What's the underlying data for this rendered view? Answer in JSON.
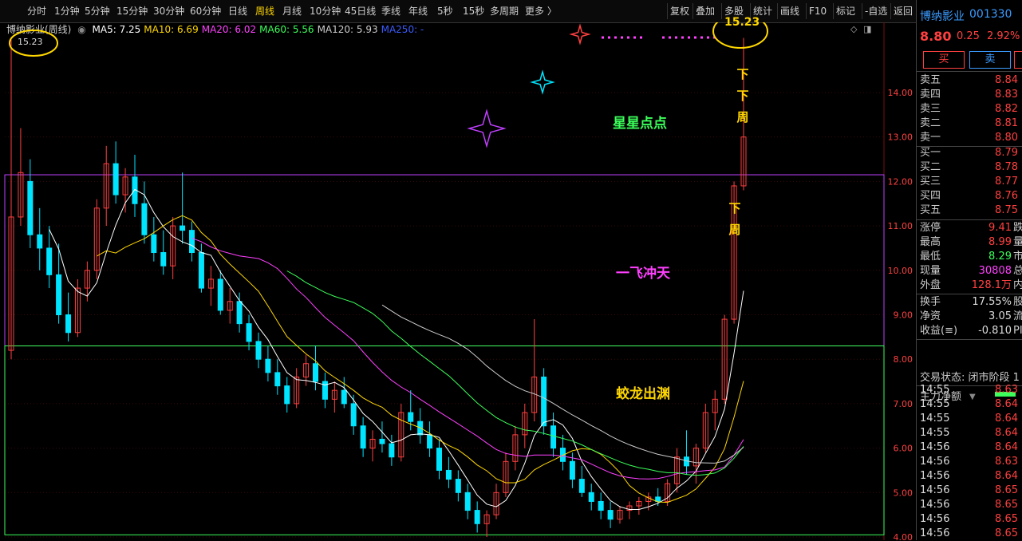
{
  "toolbar": {
    "periods": [
      "分时",
      "1分钟",
      "5分钟",
      "15分钟",
      "30分钟",
      "60分钟",
      "日线",
      "周线",
      "月线",
      "10分钟",
      "45日线",
      "季线",
      "年线",
      "5秒",
      "15秒",
      "多周期",
      "更多 〉"
    ],
    "active_period": "周线",
    "right_buttons": [
      "复权",
      "叠加",
      "多股",
      "统计",
      "画线",
      "F10",
      "标记",
      "-自选",
      "返回"
    ]
  },
  "ma_bar": {
    "title": "博纳影业(周线)",
    "items": [
      {
        "label": "MA5:",
        "value": "7.25",
        "color": "#ffffff"
      },
      {
        "label": "MA10:",
        "value": "6.69",
        "color": "#ffd700"
      },
      {
        "label": "MA20:",
        "value": "6.02",
        "color": "#ff40ff"
      },
      {
        "label": "MA60:",
        "value": "5.56",
        "color": "#3bff5a"
      },
      {
        "label": "MA120:",
        "value": "5.93",
        "color": "#cccccc"
      },
      {
        "label": "MA250:",
        "value": "-",
        "color": "#3b5bff"
      }
    ]
  },
  "annotations": {
    "high_left": "15.23",
    "high_right": "15.23",
    "stars_text": "星星点点",
    "soar_text": "一飞冲天",
    "dragon_text": "蛟龙出渊",
    "down_week_1": [
      "下",
      "下",
      "周"
    ],
    "down_week_2": [
      "下",
      "周"
    ]
  },
  "colors": {
    "up": "#ff4040",
    "down": "#00e5ff",
    "ma5": "#ffffff",
    "ma10": "#ffd700",
    "ma20": "#ff40ff",
    "ma60": "#3bff5a",
    "ma120": "#cccccc"
  },
  "chart_data": {
    "type": "candlestick",
    "title": "博纳影业(周线)",
    "y_ticks": [
      "14.00",
      "13.00",
      "12.00",
      "11.00",
      "10.00",
      "9.00",
      "8.00",
      "7.00",
      "6.00",
      "5.00",
      "4.00"
    ],
    "ylim": [
      4.0,
      15.4
    ],
    "candles_ohlc": [
      [
        8.2,
        15.2,
        8.0,
        11.2
      ],
      [
        11.2,
        13.2,
        11.0,
        12.2
      ],
      [
        12.0,
        12.5,
        10.5,
        10.8
      ],
      [
        10.8,
        11.4,
        10.0,
        10.5
      ],
      [
        10.5,
        11.0,
        9.6,
        9.9
      ],
      [
        9.9,
        10.6,
        8.8,
        9.0
      ],
      [
        9.0,
        9.5,
        8.4,
        8.6
      ],
      [
        8.6,
        9.8,
        8.5,
        9.6
      ],
      [
        9.6,
        10.2,
        9.3,
        10.0
      ],
      [
        10.0,
        11.6,
        9.8,
        11.4
      ],
      [
        11.4,
        12.8,
        11.0,
        12.4
      ],
      [
        12.4,
        12.9,
        11.5,
        11.7
      ],
      [
        11.7,
        12.3,
        11.3,
        12.1
      ],
      [
        12.1,
        12.6,
        11.2,
        11.5
      ],
      [
        11.5,
        12.0,
        10.6,
        10.8
      ],
      [
        10.8,
        11.2,
        10.2,
        10.4
      ],
      [
        10.4,
        10.9,
        9.9,
        10.1
      ],
      [
        10.1,
        11.2,
        9.8,
        11.0
      ],
      [
        11.0,
        12.2,
        10.6,
        10.9
      ],
      [
        10.9,
        11.1,
        10.2,
        10.4
      ],
      [
        10.4,
        10.6,
        9.5,
        9.6
      ],
      [
        9.6,
        10.1,
        9.2,
        9.8
      ],
      [
        9.8,
        10.0,
        9.0,
        9.1
      ],
      [
        9.1,
        9.6,
        8.8,
        9.3
      ],
      [
        9.3,
        9.5,
        8.6,
        8.8
      ],
      [
        8.8,
        9.0,
        8.2,
        8.4
      ],
      [
        8.4,
        8.6,
        7.8,
        8.0
      ],
      [
        8.0,
        8.3,
        7.5,
        7.7
      ],
      [
        7.7,
        8.0,
        7.2,
        7.4
      ],
      [
        7.4,
        7.6,
        6.8,
        7.0
      ],
      [
        7.0,
        7.8,
        6.9,
        7.6
      ],
      [
        7.6,
        8.1,
        7.4,
        7.9
      ],
      [
        7.9,
        8.3,
        7.3,
        7.5
      ],
      [
        7.5,
        7.7,
        6.9,
        7.1
      ],
      [
        7.1,
        7.5,
        6.8,
        7.3
      ],
      [
        7.3,
        7.6,
        6.9,
        7.0
      ],
      [
        7.0,
        7.2,
        6.3,
        6.5
      ],
      [
        6.5,
        6.7,
        5.8,
        6.0
      ],
      [
        6.0,
        6.4,
        5.7,
        6.2
      ],
      [
        6.2,
        6.6,
        5.9,
        6.1
      ],
      [
        6.1,
        6.3,
        5.6,
        5.8
      ],
      [
        5.8,
        7.0,
        5.7,
        6.8
      ],
      [
        6.8,
        7.3,
        6.4,
        6.6
      ],
      [
        6.6,
        6.9,
        6.1,
        6.3
      ],
      [
        6.3,
        6.6,
        5.8,
        6.0
      ],
      [
        6.0,
        6.2,
        5.3,
        5.5
      ],
      [
        5.5,
        5.8,
        5.1,
        5.3
      ],
      [
        5.3,
        5.5,
        4.8,
        5.0
      ],
      [
        5.0,
        5.2,
        4.4,
        4.6
      ],
      [
        4.6,
        4.8,
        4.1,
        4.3
      ],
      [
        4.3,
        4.6,
        4.0,
        4.5
      ],
      [
        4.5,
        5.2,
        4.4,
        5.0
      ],
      [
        5.0,
        5.9,
        4.9,
        5.7
      ],
      [
        5.7,
        6.5,
        5.5,
        6.3
      ],
      [
        6.3,
        7.0,
        6.0,
        6.8
      ],
      [
        6.8,
        8.9,
        6.6,
        7.6
      ],
      [
        7.6,
        7.8,
        6.3,
        6.5
      ],
      [
        6.5,
        6.8,
        5.8,
        6.0
      ],
      [
        6.0,
        6.3,
        5.5,
        5.7
      ],
      [
        5.7,
        5.9,
        5.1,
        5.3
      ],
      [
        5.3,
        5.6,
        4.9,
        5.0
      ],
      [
        5.0,
        5.2,
        4.6,
        4.8
      ],
      [
        4.8,
        5.0,
        4.4,
        4.6
      ],
      [
        4.6,
        4.8,
        4.2,
        4.4
      ],
      [
        4.4,
        4.7,
        4.3,
        4.6
      ],
      [
        4.6,
        4.8,
        4.4,
        4.7
      ],
      [
        4.7,
        4.9,
        4.5,
        4.8
      ],
      [
        4.8,
        5.0,
        4.6,
        4.9
      ],
      [
        4.9,
        5.1,
        4.7,
        4.8
      ],
      [
        4.8,
        5.3,
        4.7,
        5.2
      ],
      [
        5.2,
        6.0,
        5.0,
        5.8
      ],
      [
        5.8,
        6.4,
        5.4,
        5.6
      ],
      [
        5.6,
        6.1,
        5.2,
        6.0
      ],
      [
        6.0,
        7.0,
        5.9,
        6.8
      ],
      [
        6.8,
        7.3,
        6.4,
        7.1
      ],
      [
        7.1,
        9.0,
        7.0,
        8.9
      ],
      [
        8.9,
        12.0,
        8.8,
        11.9
      ],
      [
        11.9,
        15.23,
        11.8,
        13.0
      ]
    ],
    "ma_series": [
      "MA5",
      "MA10",
      "MA20",
      "MA60",
      "MA120"
    ]
  },
  "panel": {
    "name": "博纳影业",
    "code": "001330",
    "price": "8.80",
    "change": "0.25",
    "pct": "2.92%",
    "buy_btn": "买",
    "sell_btn": "卖",
    "asks": [
      {
        "k": "卖五",
        "v": "8.84"
      },
      {
        "k": "卖四",
        "v": "8.83"
      },
      {
        "k": "卖三",
        "v": "8.82"
      },
      {
        "k": "卖二",
        "v": "8.81"
      },
      {
        "k": "卖一",
        "v": "8.80"
      }
    ],
    "bids": [
      {
        "k": "买一",
        "v": "8.79"
      },
      {
        "k": "买二",
        "v": "8.78"
      },
      {
        "k": "买三",
        "v": "8.77"
      },
      {
        "k": "买四",
        "v": "8.76"
      },
      {
        "k": "买五",
        "v": "8.75"
      }
    ],
    "stats": [
      {
        "k": "涨停",
        "v": "9.41",
        "x": "跌",
        "c": "red"
      },
      {
        "k": "最高",
        "v": "8.99",
        "x": "量",
        "c": "red"
      },
      {
        "k": "最低",
        "v": "8.29",
        "x": "市",
        "c": "green"
      },
      {
        "k": "现量",
        "v": "30808",
        "x": "总",
        "c": "mag"
      },
      {
        "k": "外盘",
        "v": "128.1万",
        "x": "内",
        "c": "red"
      }
    ],
    "stats2": [
      {
        "k": "换手",
        "v": "17.55%",
        "x": "股",
        "c": "white"
      },
      {
        "k": "净资",
        "v": "3.05",
        "x": "流",
        "c": "white"
      },
      {
        "k": "收益(≡)",
        "v": "-0.810",
        "x": "PI",
        "c": "white"
      }
    ],
    "trade_status": "交易状态: 闭市阶段 1",
    "flow_label": "主力净额",
    "ticks": [
      {
        "t": "14:55",
        "p": "8.63"
      },
      {
        "t": "14:55",
        "p": "8.64"
      },
      {
        "t": "14:55",
        "p": "8.64"
      },
      {
        "t": "14:55",
        "p": "8.64"
      },
      {
        "t": "14:56",
        "p": "8.64"
      },
      {
        "t": "14:56",
        "p": "8.63"
      },
      {
        "t": "14:56",
        "p": "8.64"
      },
      {
        "t": "14:56",
        "p": "8.65"
      },
      {
        "t": "14:56",
        "p": "8.65"
      },
      {
        "t": "14:56",
        "p": "8.65"
      },
      {
        "t": "14:56",
        "p": "8.65"
      }
    ]
  }
}
